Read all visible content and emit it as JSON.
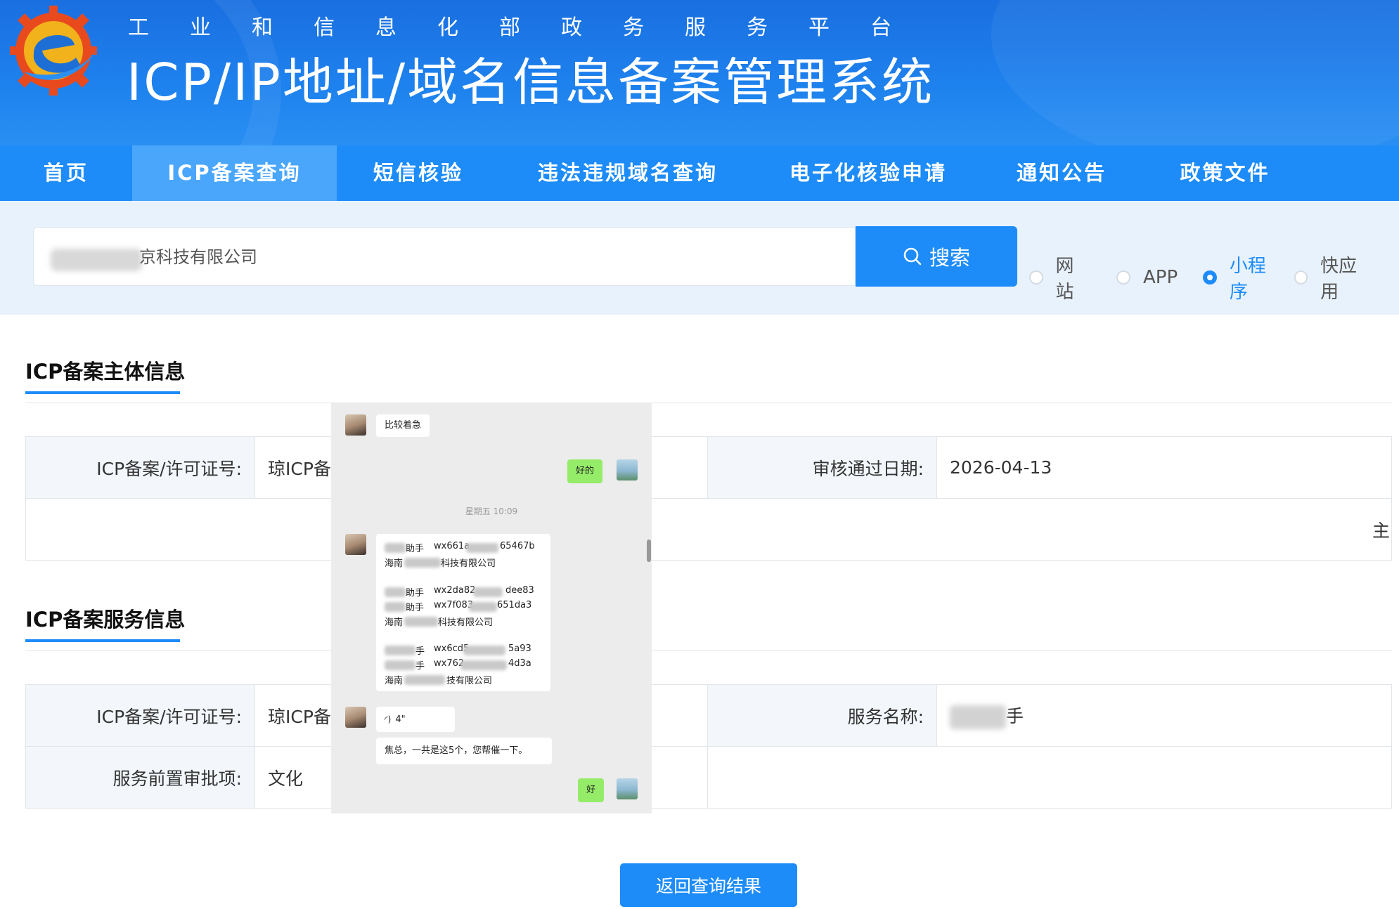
{
  "header": {
    "subtitle": "工业和信息化部政务服务平台",
    "title": "ICP/IP地址/域名信息备案管理系统"
  },
  "nav": {
    "items": [
      {
        "label": "首页",
        "active": false
      },
      {
        "label": "ICP备案查询",
        "active": true
      },
      {
        "label": "短信核验",
        "active": false
      },
      {
        "label": "违法违规域名查询",
        "active": false
      },
      {
        "label": "电子化核验申请",
        "active": false
      },
      {
        "label": "通知公告",
        "active": false
      },
      {
        "label": "政策文件",
        "active": false
      }
    ]
  },
  "search": {
    "value": "京科技有限公司",
    "button_label": "搜索",
    "options": [
      {
        "label": "网站",
        "selected": false
      },
      {
        "label": "APP",
        "selected": false
      },
      {
        "label": "小程序",
        "selected": true
      },
      {
        "label": "快应用",
        "selected": false
      }
    ]
  },
  "subject_section": {
    "title": "ICP备案主体信息",
    "license_label": "ICP备案/许可证号:",
    "license_value": "琼ICP备",
    "date_label": "审核通过日期:",
    "date_value": "2026-04-13",
    "row2_value": "主"
  },
  "service_section": {
    "title": "ICP备案服务信息",
    "license_label": "ICP备案/许可证号:",
    "license_value": "琼ICP备",
    "service_name_label": "服务名称:",
    "service_name_value": "手",
    "approval_label": "服务前置审批项:",
    "approval_value": "文化"
  },
  "back_button": "返回查询结果",
  "chat": {
    "msg1": "比较着急",
    "reply1": "好的",
    "timestamp": "星期五 10:09",
    "list": {
      "l1a": "助手",
      "l1b": "wx661a",
      "l1c": "65467b",
      "l2a": "海南",
      "l2b": "科技有限公司",
      "l3a": "助手",
      "l3b": "wx2da82",
      "l3c": "dee83",
      "l4a": "助手",
      "l4b": "wx7f083",
      "l4c": "651da3",
      "l5a": "海南",
      "l5b": "科技有限公司",
      "l6a": "手",
      "l6b": "wx6cd5",
      "l6c": "5a93",
      "l7a": "手",
      "l7b": "wx762",
      "l7c": "4d3a",
      "l8a": "海南",
      "l8b": "技有限公司"
    },
    "voice": "4\"",
    "msg3": "焦总，一共是这5个，您帮催一下。",
    "reply2": "好"
  }
}
